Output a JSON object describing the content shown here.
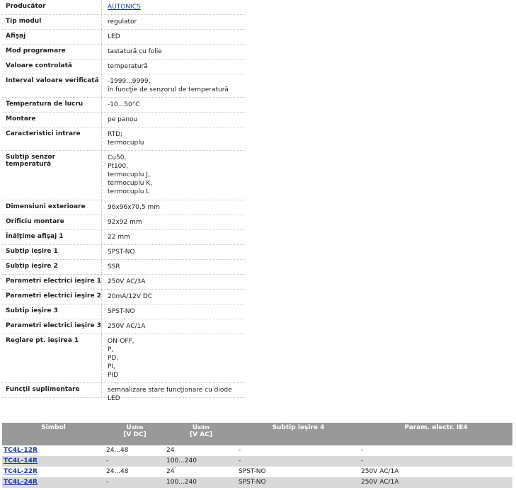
{
  "specs": [
    {
      "label": "Producător",
      "value": "AUTONICS",
      "link": true,
      "h": 21
    },
    {
      "label": "Tip modul",
      "value": "regulator",
      "h": 21
    },
    {
      "label": "Afişaj",
      "value": "LED",
      "h": 21
    },
    {
      "label": "Mod programare",
      "value": "tastatură cu folie",
      "h": 21
    },
    {
      "label": "Valoare controlată",
      "value": "temperatură",
      "h": 21
    },
    {
      "label": "Interval valoare verificată",
      "value": "-1999...9999,\nîn funcţie de senzorul de temperatură",
      "h": 33
    },
    {
      "label": "Temperatura de lucru",
      "value": "-10...50°C",
      "h": 21
    },
    {
      "label": "Montare",
      "value": "pe panou",
      "h": 21
    },
    {
      "label": "Caracteristici intrare",
      "value": "RTD;\ntermocuplu",
      "h": 33
    },
    {
      "label": "Subtip senzor temperatură",
      "value": "Cu50,\nPt100,\ntermocuplu J,\ntermocuplu K,\ntermocuplu L",
      "h": 70
    },
    {
      "label": "Dimensiuni exterioare",
      "value": "96x96x70,5 mm",
      "h": 21
    },
    {
      "label": "Orificiu montare",
      "value": "92x92 mm",
      "h": 21
    },
    {
      "label": "Înălţime afişaj 1",
      "value": "22 mm",
      "h": 21
    },
    {
      "label": "Subtip ieşire 1",
      "value": "SPST-NO",
      "h": 21
    },
    {
      "label": "Subtip ieşire 2",
      "value": "SSR",
      "h": 21
    },
    {
      "label": "Parametri electrici ieşire 1",
      "value": "250V AC/3A",
      "h": 21
    },
    {
      "label": "Parametri electrici ieşire 2",
      "value": "20mA/12V DC",
      "h": 21
    },
    {
      "label": "Subtip ieşire 3",
      "value": "SPST-NO",
      "h": 21
    },
    {
      "label": "Parametri electrici ieşire 3",
      "value": "250V AC/1A",
      "h": 21
    },
    {
      "label": "Reglare pt. ieşirea 1",
      "value": "ON-OFF,\nP,\nPD,\nPI,\nPID",
      "h": 69
    },
    {
      "label": "Funcţii suplimentare",
      "value": "semnalizare stare funcţionare cu diode LED",
      "h": 21
    }
  ],
  "variants": {
    "headers": {
      "symbol": "Simbol",
      "ualim_dc_main": "U",
      "ualim_dc_sub": "alim",
      "ualim_dc_unit": "[V DC]",
      "ualim_ac_main": "U",
      "ualim_ac_sub": "alim",
      "ualim_ac_unit": "[V AC]",
      "subtip": "Subtip ieşire 4",
      "param": "Param. electr. IE4"
    },
    "rows": [
      {
        "symbol": "TC4L-12R",
        "dc": "24...48",
        "ac": "24",
        "subtip": "-",
        "param": "-"
      },
      {
        "symbol": "TC4L-14R",
        "dc": "-",
        "ac": "100...240",
        "subtip": "-",
        "param": "-"
      },
      {
        "symbol": "TC4L-22R",
        "dc": "24...48",
        "ac": "24",
        "subtip": "SPST-NO",
        "param": "250V AC/1A"
      },
      {
        "symbol": "TC4L-24R",
        "dc": "-",
        "ac": "100...240",
        "subtip": "SPST-NO",
        "param": "250V AC/1A"
      }
    ]
  }
}
